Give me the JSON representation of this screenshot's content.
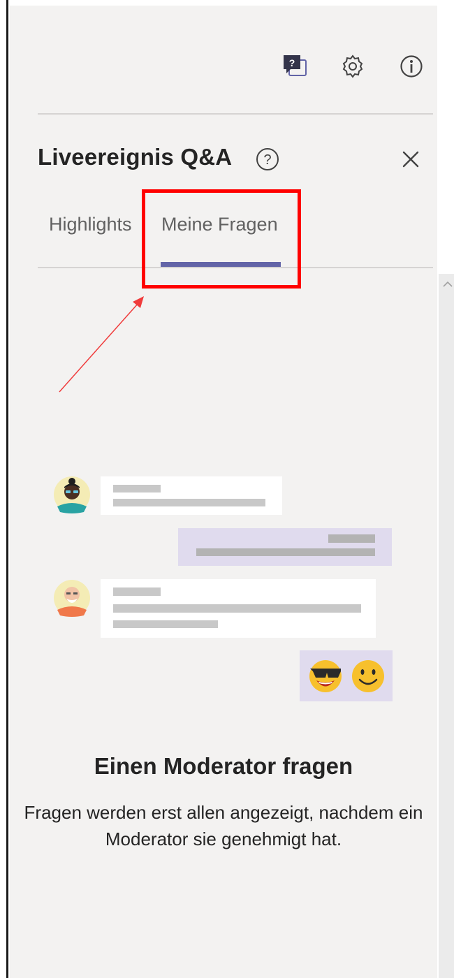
{
  "panel": {
    "title": "Liveereignis Q&A",
    "tabs": [
      {
        "label": "Highlights",
        "selected": false
      },
      {
        "label": "Meine Fragen",
        "selected": true
      }
    ]
  },
  "toolbar_icons": [
    "qa-icon",
    "gear-icon",
    "info-icon"
  ],
  "empty_state": {
    "heading": "Einen Moderator fragen",
    "description_line1": "Fragen werden erst allen angezeigt, nachdem ein",
    "description_line2": "Moderator sie genehmigt hat."
  },
  "colors": {
    "accent": "#6264a7",
    "panel_bg": "#f3f2f1",
    "annotation": "#ff0000",
    "bubble_purple": "#e0dbee"
  }
}
